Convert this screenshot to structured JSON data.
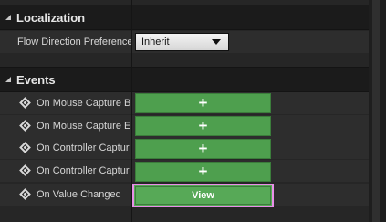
{
  "localization": {
    "header": "Localization",
    "flow_label": "Flow Direction Preference",
    "flow_value": "Inherit"
  },
  "events": {
    "header": "Events",
    "items": [
      {
        "label": "On Mouse Capture Begin",
        "button": "+"
      },
      {
        "label": "On Mouse Capture End",
        "button": "+"
      },
      {
        "label": "On Controller Capture Begin",
        "button": "+"
      },
      {
        "label": "On Controller Capture End",
        "button": "+"
      },
      {
        "label": "On Value Changed",
        "button": "View"
      }
    ]
  },
  "icons": {
    "collapse": "triangle-collapse-icon",
    "event": "event-diamond-icon",
    "dropdown": "chevron-down-icon"
  },
  "colors": {
    "button_green": "#4e9f4e",
    "highlight_border": "#e890e8"
  }
}
